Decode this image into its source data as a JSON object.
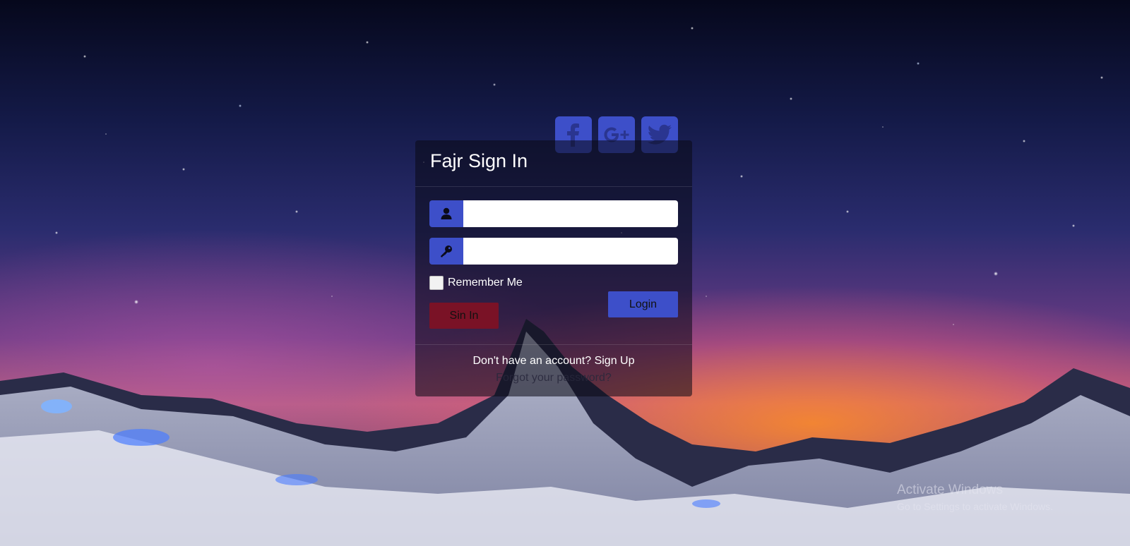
{
  "login": {
    "title": "Fajr Sign In",
    "username": {
      "value": "",
      "placeholder": "",
      "icon": "user-icon"
    },
    "password": {
      "value": "",
      "placeholder": "",
      "icon": "key-icon"
    },
    "remember_label": "Remember Me",
    "signin_label": "Sin In",
    "login_label": "Login",
    "signup_prompt": "Don't have an account?",
    "signup_link": "Sign Up",
    "forgot_label": "Forgot your password?"
  },
  "social": [
    {
      "name": "facebook",
      "icon": "facebook-icon"
    },
    {
      "name": "google-plus",
      "icon": "google-plus-icon"
    },
    {
      "name": "twitter",
      "icon": "twitter-icon"
    }
  ],
  "watermark": {
    "line1": "Activate Windows",
    "line2": "Go to Settings to activate Windows."
  },
  "colors": {
    "accent": "#3d4fc9",
    "signin_button": "#7a1226",
    "card_background": "rgba(10,10,20,0.55)"
  }
}
